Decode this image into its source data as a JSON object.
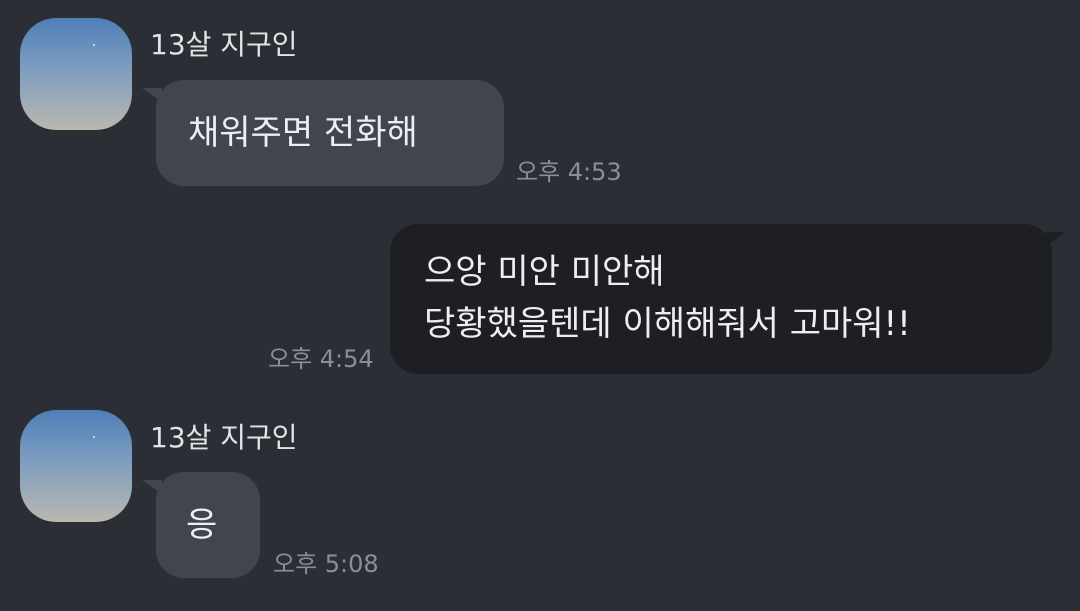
{
  "messages": [
    {
      "sender": "13살 지구인",
      "text": "채워주면 전화해",
      "time": "오후 4:53"
    },
    {
      "line1": "으앙  미안 미안해",
      "line2": "당황했을텐데 이해해줘서 고마워!!",
      "time": "오후 4:54"
    },
    {
      "sender": "13살 지구인",
      "text": "응",
      "time": "오후 5:08"
    }
  ],
  "colors": {
    "background": "#2c2e35",
    "incoming_bubble": "#42454e",
    "outgoing_bubble": "#1e1f24",
    "timestamp": "#8b8e96"
  },
  "icons": {
    "avatar": "profile-sky-avatar"
  }
}
